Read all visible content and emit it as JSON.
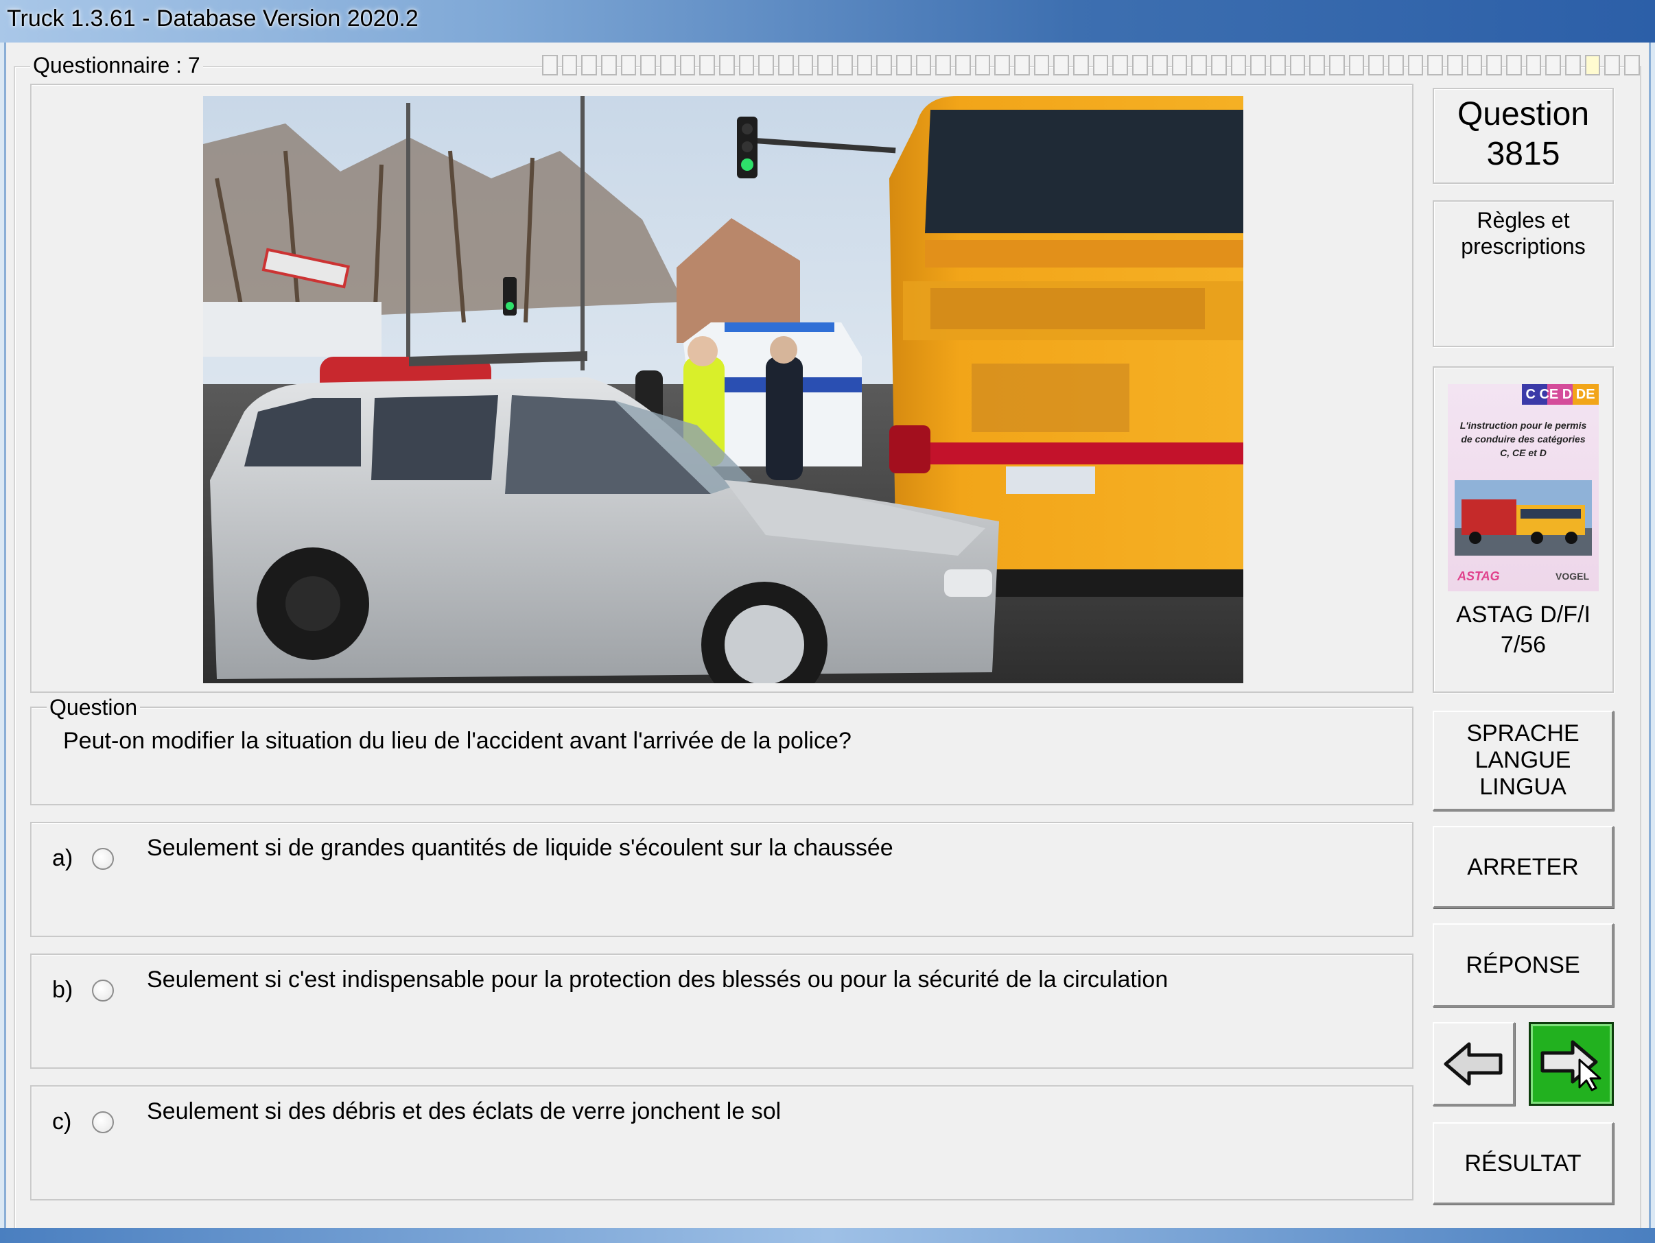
{
  "window": {
    "title": "Truck 1.3.61 - Database Version 2020.2"
  },
  "questionnaire": {
    "label": "Questionnaire : 7",
    "total_steps": 56,
    "current_step": 7
  },
  "question_panel": {
    "number_label": "Question",
    "number": "3815",
    "category": "Règles et prescriptions",
    "legend": "Question",
    "text": "Peut-on modifier la situation du lieu de l'accident avant l'arrivée de la police?"
  },
  "answers": [
    {
      "letter": "a)",
      "text": "Seulement si de grandes quantités de liquide s'écoulent sur la chaussée",
      "selected": false
    },
    {
      "letter": "b)",
      "text": "Seulement si c'est indispensable pour la protection des blessés ou pour la sécurité de la circulation",
      "selected": false
    },
    {
      "letter": "c)",
      "text": "Seulement si des débris et des éclats de verre jonchent le sol",
      "selected": false
    }
  ],
  "book": {
    "badge": "C CE D DE",
    "cover_text": "L'instruction pour le permis de conduire des catégories C, CE et D",
    "publisher_left": "ASTAG",
    "publisher_right": "VOGEL",
    "label_line1": "ASTAG D/F/I",
    "label_line2": "7/56"
  },
  "buttons": {
    "language_line1": "SPRACHE",
    "language_line2": "LANGUE",
    "language_line3": "LINGUA",
    "stop": "ARRETER",
    "answer": "RÉPONSE",
    "result": "RÉSULTAT"
  },
  "colors": {
    "next_button": "#22b11f",
    "bus": "#f2a519",
    "title_bar": "#3d6fb0"
  },
  "icons": {
    "prev": "left-arrow-icon",
    "next": "right-arrow-with-cursor-icon"
  }
}
